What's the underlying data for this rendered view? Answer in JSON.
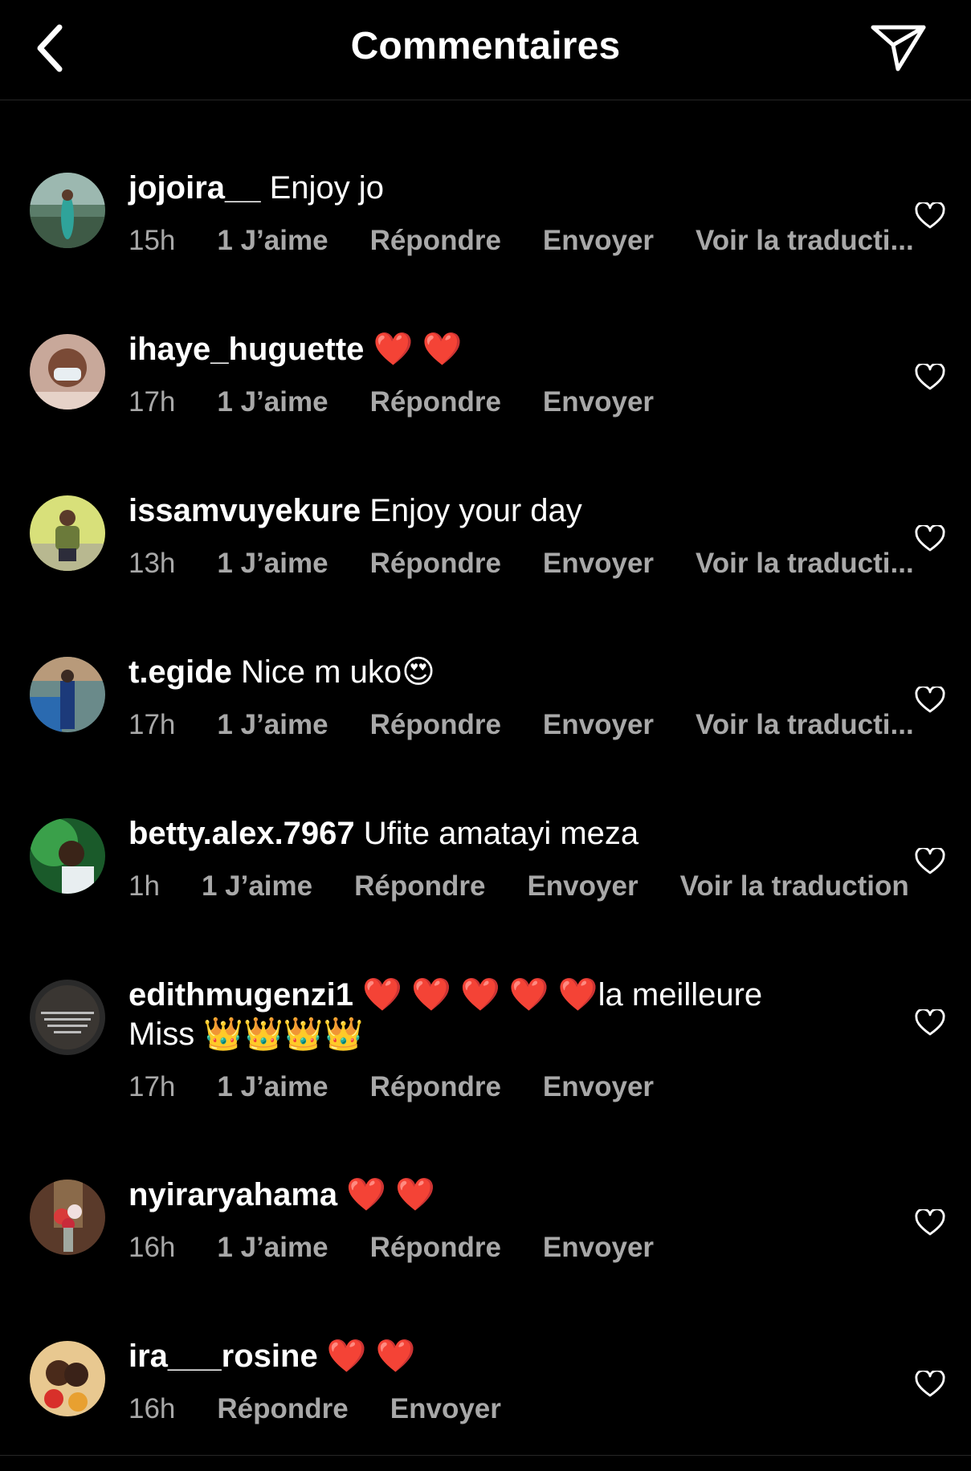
{
  "header": {
    "title": "Commentaires",
    "back_icon": "chevron-left-icon",
    "send_icon": "paper-plane-icon"
  },
  "actions": {
    "reply": "Répondre",
    "send": "Envoyer",
    "translate": "Voir la traduction",
    "translate_truncated": "Voir la traducti..."
  },
  "comments": [
    {
      "username": "jojoira__",
      "text": " Enjoy jo",
      "time": "15h",
      "likes": "1 J’aime",
      "translate": "Voir la traducti..."
    },
    {
      "username": "ihaye_huguette",
      "text": " ❤️ ❤️",
      "time": "17h",
      "likes": "1 J’aime"
    },
    {
      "username": "issamvuyekure",
      "text": " Enjoy your day",
      "time": "13h",
      "likes": "1 J’aime",
      "translate": "Voir la traducti..."
    },
    {
      "username": "t.egide",
      "text": " Nice m uko😍",
      "time": "17h",
      "likes": "1 J’aime",
      "translate": "Voir la traducti..."
    },
    {
      "username": "betty.alex.7967",
      "text": " Ufite amatayi meza",
      "time": "1h",
      "likes": "1 J’aime",
      "translate": "Voir la traduction"
    },
    {
      "username": "edithmugenzi1",
      "text": " ❤️ ❤️ ❤️ ❤️ ❤️la meilleure Miss 👑👑👑👑",
      "time": "17h",
      "likes": "1 J’aime"
    },
    {
      "username": "nyiraryahama",
      "text": " ❤️ ❤️",
      "time": "16h",
      "likes": "1 J’aime"
    },
    {
      "username": "ira___rosine",
      "text": " ❤️ ❤️",
      "time": "16h"
    }
  ],
  "colors": {
    "background": "#000000",
    "text": "#ffffff",
    "meta": "#a8a8a8",
    "divider": "#262626"
  }
}
